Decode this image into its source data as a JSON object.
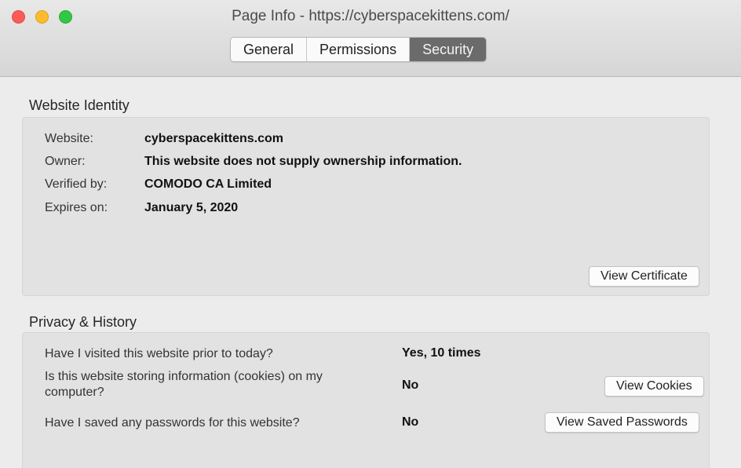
{
  "window": {
    "title": "Page Info - https://cyberspacekittens.com/"
  },
  "tabs": [
    {
      "label": "General"
    },
    {
      "label": "Permissions"
    },
    {
      "label": "Security",
      "active": true
    }
  ],
  "identity": {
    "heading": "Website Identity",
    "rows": [
      {
        "label": "Website:",
        "value": "cyberspacekittens.com"
      },
      {
        "label": "Owner:",
        "value": "This website does not supply ownership information."
      },
      {
        "label": "Verified by:",
        "value": "COMODO CA Limited"
      },
      {
        "label": "Expires on:",
        "value": "January 5, 2020"
      }
    ],
    "view_certificate_label": "View Certificate"
  },
  "privacy": {
    "heading": "Privacy & History",
    "rows": [
      {
        "question": "Have I visited this website prior to today?",
        "answer": "Yes, 10 times"
      },
      {
        "question": "Is this website storing information (cookies) on my computer?",
        "answer": "No",
        "button": "View Cookies"
      },
      {
        "question": "Have I saved any passwords for this website?",
        "answer": "No",
        "button": "View Saved Passwords"
      }
    ]
  },
  "colors": {
    "close": "#fc5b57",
    "minimize": "#fdbc2e",
    "maximize": "#33c748",
    "active_tab": "#6b6b6b"
  }
}
